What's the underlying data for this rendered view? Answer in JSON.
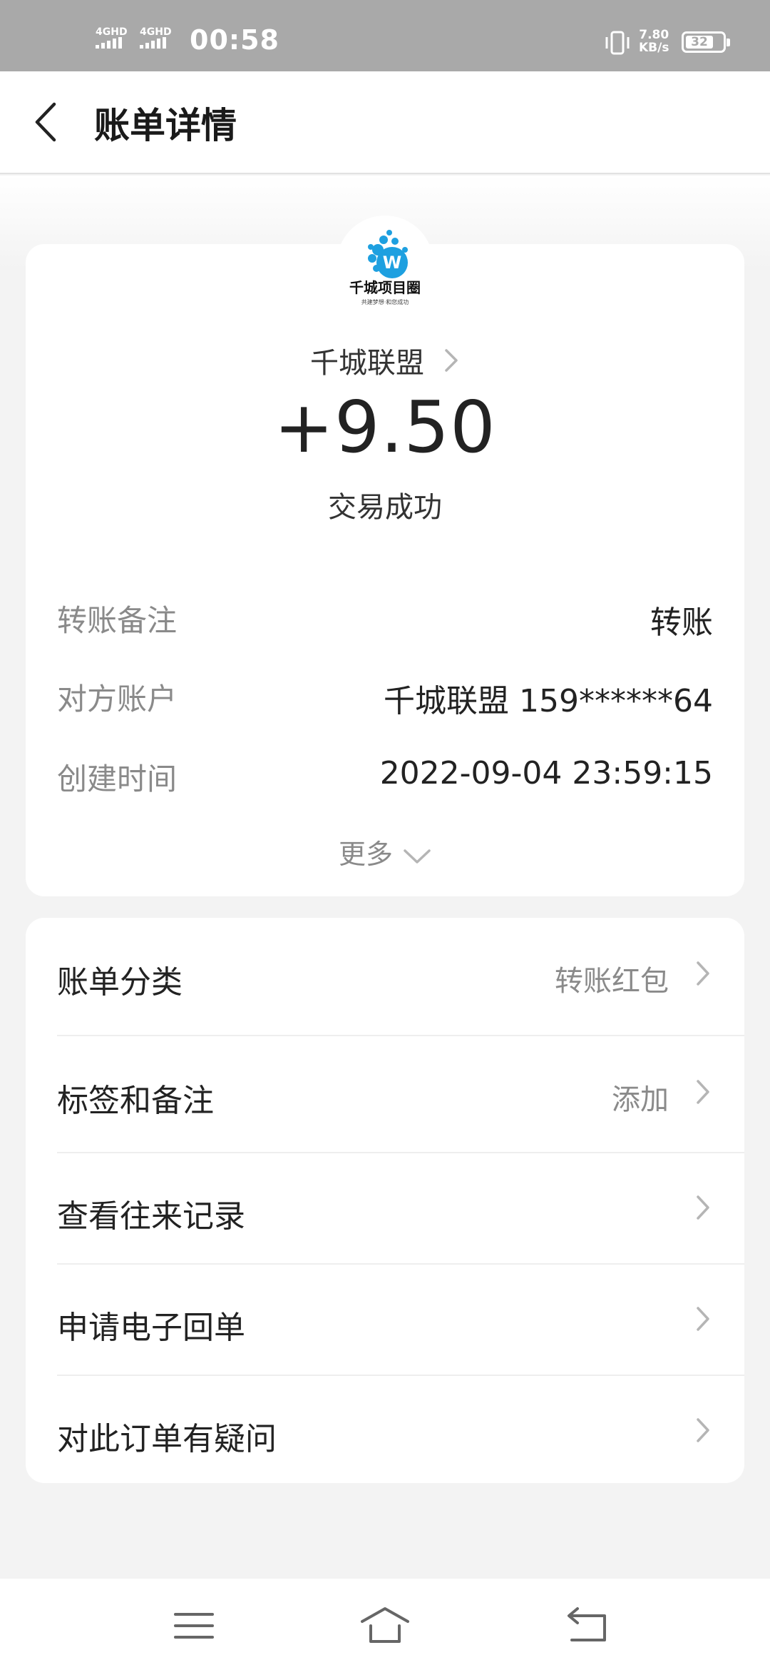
{
  "status_bar": {
    "sim1_label": "4GHD",
    "sim2_label": "4GHD",
    "time": "00:58",
    "net_speed_value": "7.80",
    "net_speed_unit": "KB/s",
    "battery": "32"
  },
  "header": {
    "title": "账单详情"
  },
  "transaction": {
    "payee": "千城联盟",
    "amount": "+9.50",
    "status": "交易成功",
    "avatar_logo_text": "千城项目圈",
    "avatar_logo_tagline": "共建梦想·和您成功"
  },
  "details": [
    {
      "label": "转账备注",
      "value": "转账"
    },
    {
      "label": "对方账户",
      "value": "千城联盟 159******64"
    },
    {
      "label": "创建时间",
      "value": "2022-09-04 23:59:15"
    }
  ],
  "more_label": "更多",
  "menu": [
    {
      "label": "账单分类",
      "value": "转账红包"
    },
    {
      "label": "标签和备注",
      "value": "添加"
    },
    {
      "label": "查看往来记录",
      "value": ""
    },
    {
      "label": "申请电子回单",
      "value": ""
    },
    {
      "label": "对此订单有疑问",
      "value": ""
    }
  ],
  "colors": {
    "status_bar_bg": "#a9a9a9",
    "page_bg": "#f3f3f3",
    "card_bg": "#ffffff",
    "logo_blue": "#1ea0e0"
  },
  "nav_icons": [
    "menu-icon",
    "home-icon",
    "back-icon"
  ]
}
